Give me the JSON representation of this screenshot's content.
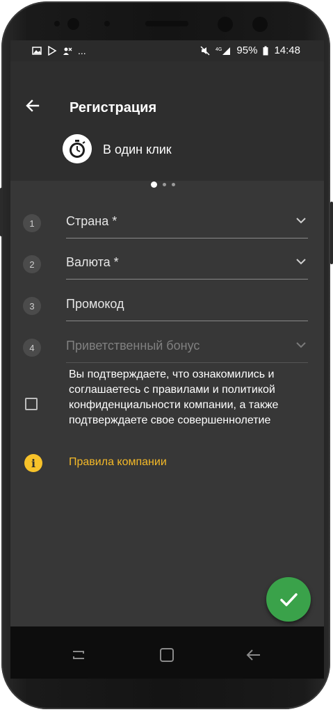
{
  "status_bar": {
    "icons_left": [
      "image-icon",
      "play-store-icon",
      "missed-call-icon"
    ],
    "more_indicator": "...",
    "icons_right": [
      "mute-icon",
      "4g-signal-icon"
    ],
    "battery": "95%",
    "time": "14:48"
  },
  "header": {
    "title": "Регистрация",
    "mode_label": "В один клик",
    "mode_icon": "stopwatch-icon",
    "pager": {
      "count": 3,
      "active": 0
    }
  },
  "form": {
    "fields": [
      {
        "number": "1",
        "label": "Страна *",
        "type": "dropdown",
        "enabled": true
      },
      {
        "number": "2",
        "label": "Валюта *",
        "type": "dropdown",
        "enabled": true
      },
      {
        "number": "3",
        "label": "Промокод",
        "type": "text",
        "enabled": true
      },
      {
        "number": "4",
        "label": "Приветственный бонус",
        "type": "dropdown",
        "enabled": false
      }
    ],
    "agreement": {
      "checked": false,
      "text": "Вы подтверждаете, что ознакомились и соглашаетесь с правилами и политикой конфиденциальности компании, а также подтверждаете свое совершеннолетие"
    },
    "rules_link": "Правила компании"
  },
  "colors": {
    "background": "#373737",
    "header_bg": "#2e2e2e",
    "accent_yellow": "#f4b928",
    "fab_green": "#3aa24a"
  },
  "fab": {
    "icon": "checkmark-icon"
  },
  "nav_bar": {
    "buttons": [
      "recents-icon",
      "home-icon",
      "back-icon"
    ]
  }
}
